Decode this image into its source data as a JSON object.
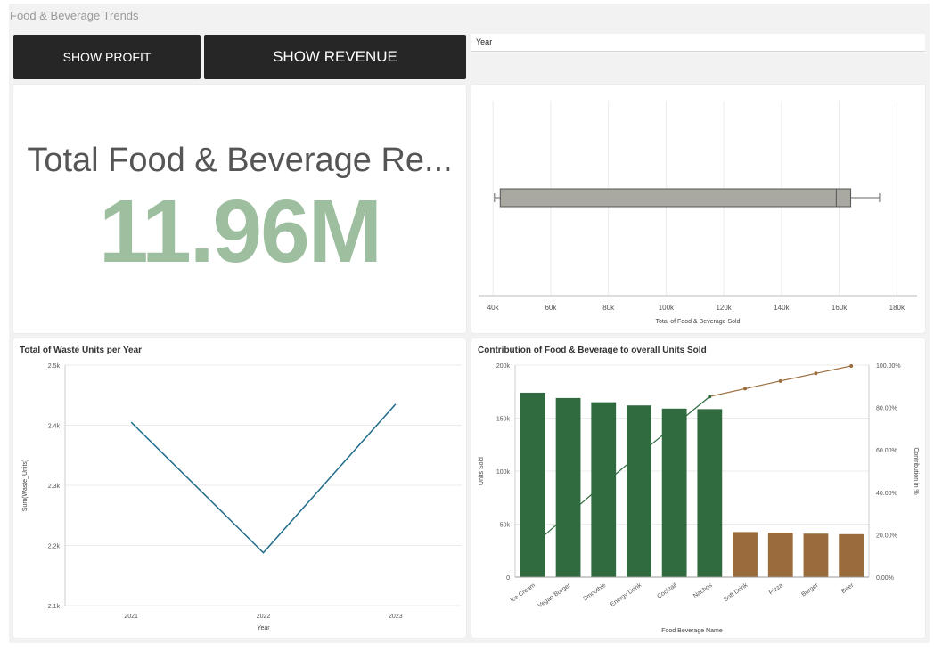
{
  "app": {
    "title": "Food & Beverage Trends"
  },
  "buttons": {
    "profit": "SHOW PROFIT",
    "revenue": "SHOW REVENUE"
  },
  "filter": {
    "year_label": "Year"
  },
  "kpi": {
    "label": "Total Food & Beverage Re...",
    "value": "11.96M",
    "value_color": "#9dbf9f"
  },
  "boxplot": {
    "chart_data": {
      "type": "boxplot",
      "xlabel": "Total of Food & Beverage Sold",
      "xlim": [
        35000,
        187000
      ],
      "ticks": [
        40000,
        60000,
        80000,
        100000,
        120000,
        140000,
        160000,
        180000
      ],
      "tick_labels": [
        "40k",
        "60k",
        "80k",
        "100k",
        "120k",
        "140k",
        "160k",
        "180k"
      ],
      "min": 40500,
      "q1": 42500,
      "median": 159000,
      "q3": 164000,
      "max": 174000,
      "color": "#a9a9a2"
    }
  },
  "waste": {
    "title": "Total of Waste Units per Year",
    "chart_data": {
      "type": "line",
      "categories": [
        "2021",
        "2022",
        "2023"
      ],
      "values": [
        2405,
        2188,
        2435
      ],
      "xlabel": "Year",
      "ylabel": "Sum(Waste_Units)",
      "ylim": [
        2100,
        2500
      ],
      "ticks": [
        2100,
        2200,
        2300,
        2400,
        2500
      ],
      "tick_labels": [
        "2.1k",
        "2.2k",
        "2.3k",
        "2.4k",
        "2.5k"
      ],
      "color": "#1f6b8a"
    }
  },
  "pareto": {
    "title": "Contribution of Food & Beverage to overall Units Sold",
    "chart_data": {
      "type": "bar",
      "categories": [
        "Ice Cream",
        "Vegan Burger",
        "Smoothie",
        "Energy Drink",
        "Cocktail",
        "Nachos",
        "Soft Drink",
        "Pizza",
        "Burger",
        "Beer"
      ],
      "values": [
        174000,
        169000,
        165000,
        162000,
        159000,
        158500,
        42500,
        42000,
        41000,
        40500
      ],
      "cumulative_pct": [
        15.0,
        29.5,
        43.8,
        57.8,
        71.5,
        85.2,
        88.9,
        92.5,
        96.1,
        99.6
      ],
      "bar_colors": [
        "#2f6b3f",
        "#2f6b3f",
        "#2f6b3f",
        "#2f6b3f",
        "#2f6b3f",
        "#2f6b3f",
        "#9a6c3c",
        "#9a6c3c",
        "#9a6c3c",
        "#9a6c3c"
      ],
      "line_colors": [
        "#2f6b3f",
        "#2f6b3f",
        "#2f6b3f",
        "#2f6b3f",
        "#2f6b3f",
        "#2f6b3f",
        "#9a6c3c",
        "#9a6c3c",
        "#9a6c3c",
        "#9a6c3c"
      ],
      "xlabel": "Food Beverage Name",
      "ylabel": "Units Sold",
      "y2label": "Contribution in %",
      "ylim": [
        0,
        200000
      ],
      "ticks": [
        0,
        50000,
        100000,
        150000,
        200000
      ],
      "tick_labels": [
        "0",
        "50k",
        "100k",
        "150k",
        "200k"
      ],
      "y2lim": [
        0,
        100
      ],
      "y2ticks": [
        0,
        20,
        40,
        60,
        80,
        100
      ],
      "y2tick_labels": [
        "0.00%",
        "20.00%",
        "40.00%",
        "60.00%",
        "80.00%",
        "100.00%"
      ]
    }
  }
}
